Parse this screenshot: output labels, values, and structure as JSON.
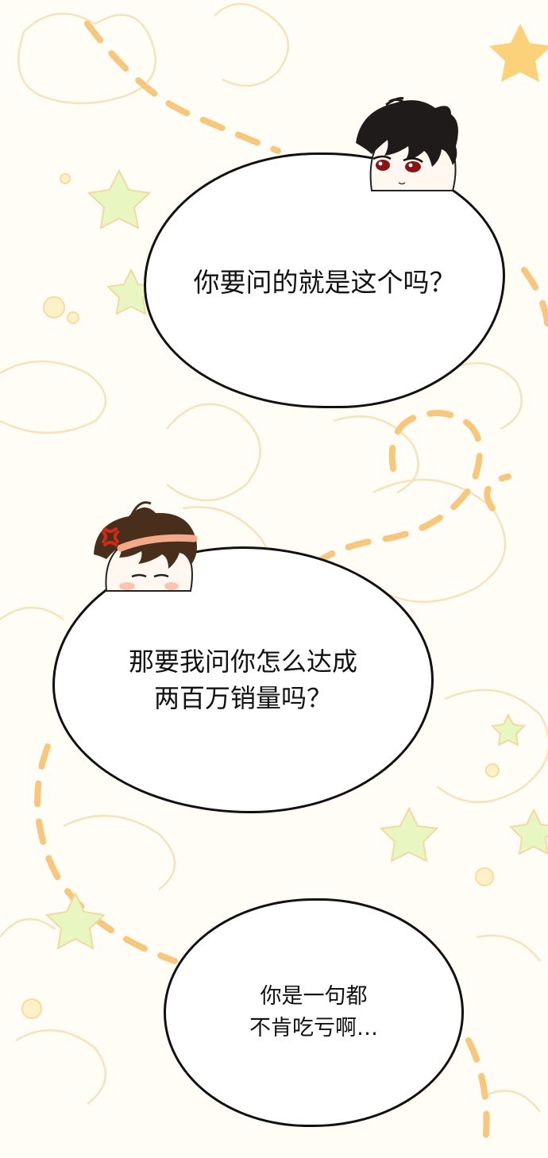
{
  "bubbles": [
    {
      "lines": [
        "你要问的就是这个吗？"
      ]
    },
    {
      "lines": [
        "那要我问你怎么达成",
        "两百万销量吗？"
      ]
    },
    {
      "lines": [
        "你是一句都",
        "不肯吃亏啊…"
      ]
    }
  ],
  "characters": [
    {
      "icon": "dark-hair-boy-peeking-icon",
      "hair_color": "#1f1b1b",
      "eye_color": "#8a1414"
    },
    {
      "icon": "angry-brown-hair-boy-peeking-icon",
      "hair_color": "#4a2e1c",
      "anger_mark_color": "#d12a1a",
      "headband_color": "#f3a98a"
    }
  ],
  "colors": {
    "background": "#fffdf6",
    "doodle_line": "#f7e2bd",
    "dashes": "#f6c77c",
    "star_green": "#e8f7c2",
    "star_orange": "#fbd17a"
  }
}
